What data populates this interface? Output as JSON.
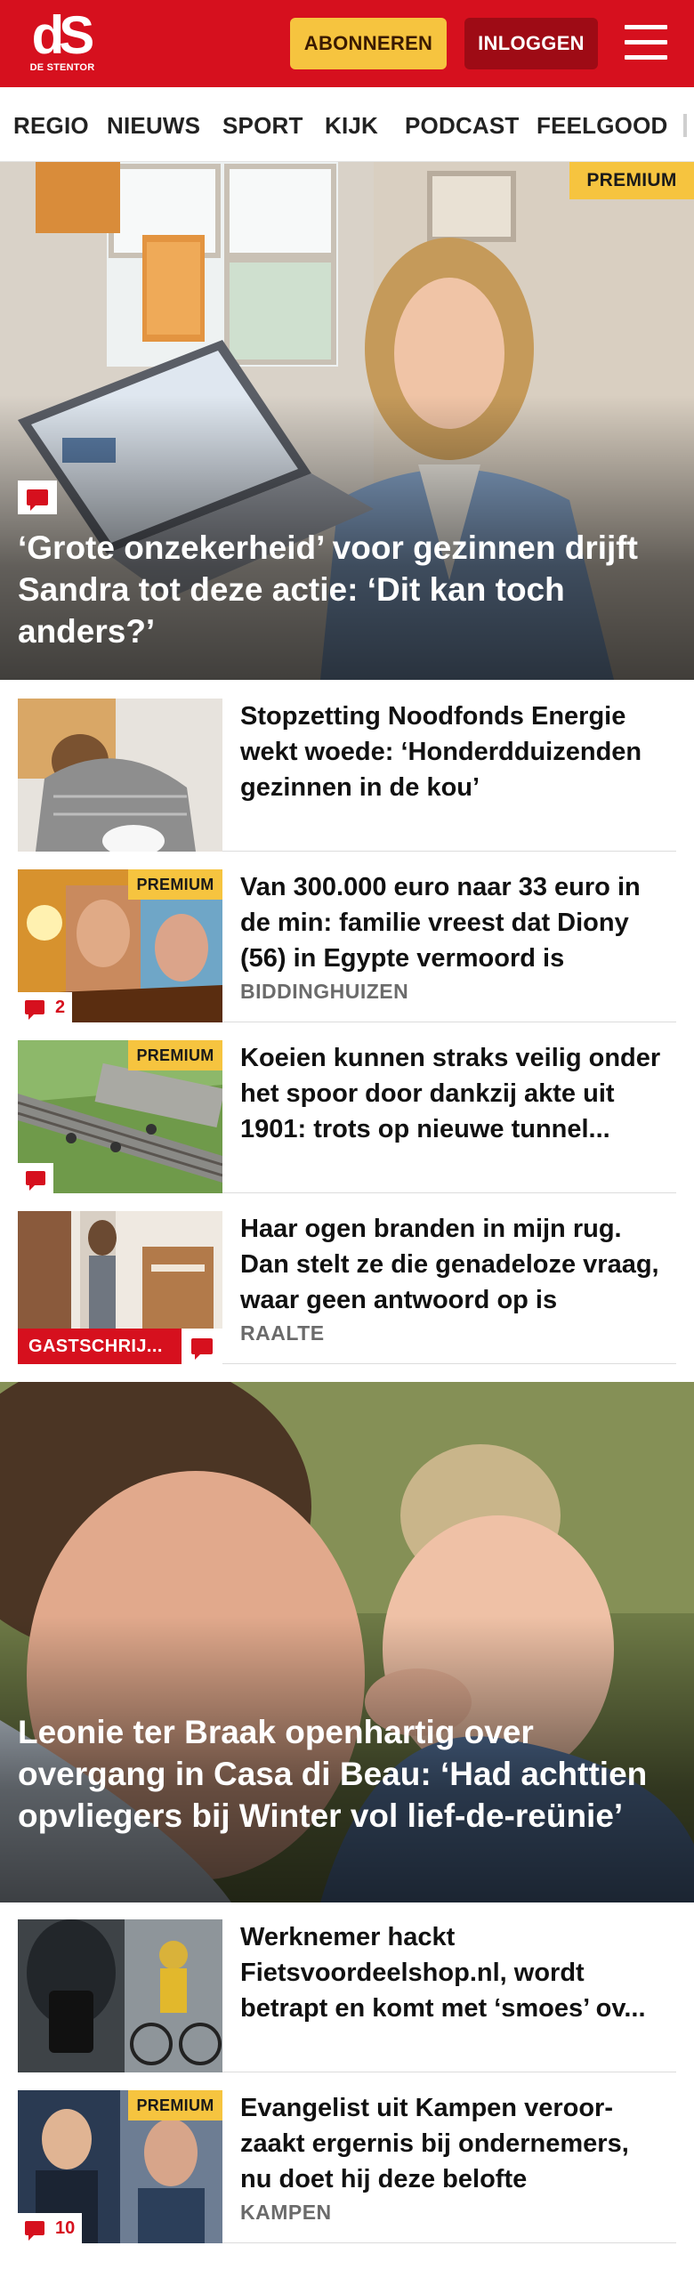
{
  "header": {
    "logo_mark": "dS",
    "logo_sub": "DE STENTOR",
    "subscribe_label": "ABONNEREN",
    "login_label": "INLOGGEN",
    "brand_color": "#d6101e",
    "menu_icon": "hamburger-menu-icon"
  },
  "nav": {
    "items": [
      "REGIO",
      "NIEUWS",
      "SPORT",
      "KIJK",
      "PODCAST",
      "FEELGOOD"
    ]
  },
  "labels": {
    "premium": "PREMIUM",
    "guest_writer": "GASTSCHRIJ..."
  },
  "hero1": {
    "title": "‘Grote onzekerheid’ voor gezinnen drijft Sandra tot deze actie: ‘Dit kan toch anders?’",
    "has_comments_icon": true
  },
  "articles": [
    {
      "title": "Stopzetting Noodfonds Energie wekt woede: ‘Honderdduizenden gezinnen in de kou’",
      "location": ""
    },
    {
      "title": "Van 300.000 euro naar 33 euro in de min: familie vreest dat Diony (56) in Egypte vermoord is",
      "location": "BIDDINGHUIZEN",
      "comments": "2"
    },
    {
      "title": "Koeien kunnen straks veilig onder het spoor door dankzij akte uit 1901: trots op nieuwe tunnel...",
      "location": ""
    },
    {
      "title": "Haar ogen branden in mijn rug. Dan stelt ze die genadeloze vraag, waar geen antwoord op is",
      "location": "RAALTE"
    }
  ],
  "hero2": {
    "title": "Leonie ter Braak openhartig over overgang in Casa di Beau: ‘Had achttien opvliegers bij Winter vol lief-de-reünie’"
  },
  "articles2": [
    {
      "title": "Werknemer hackt Fietsvoordeelshop.nl, wordt betrapt en komt met ‘smoes’ ov...",
      "location": ""
    },
    {
      "title": "Evangelist uit Kampen veroor-zaakt ergernis bij ondernemers, nu doet hij deze belofte",
      "location": "KAMPEN",
      "comments": "10"
    }
  ]
}
